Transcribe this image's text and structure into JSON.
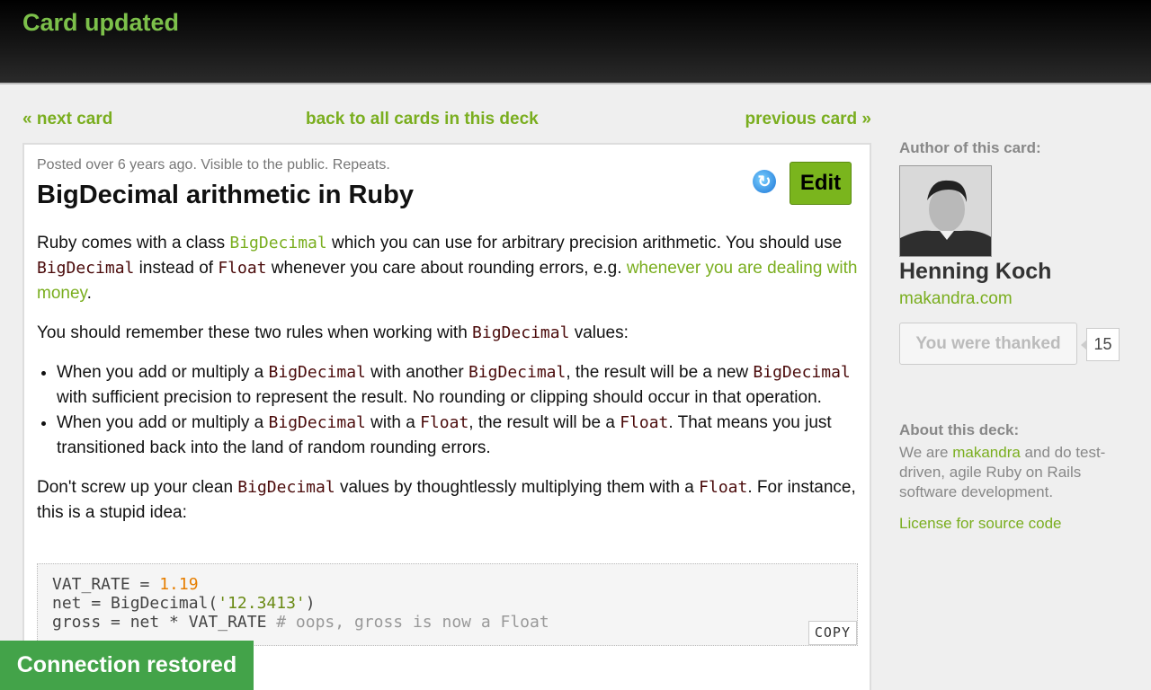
{
  "header": {
    "flash": "Card updated"
  },
  "nav": {
    "next": "« next card",
    "back": "back to all cards in this deck",
    "previous": "previous card »"
  },
  "card": {
    "meta": "Posted over 6 years ago. Visible to the public. Repeats.",
    "title": "BigDecimal arithmetic in Ruby",
    "edit_label": "Edit",
    "p1": {
      "t1": "Ruby comes with a class ",
      "c1": "BigDecimal",
      "t2": " which you can use for arbitrary precision arithmetic. You should use ",
      "c2": "BigDecimal",
      "t3": " instead of ",
      "c3": "Float",
      "t4": " whenever you care about rounding errors, e.g. ",
      "link": "whenever you are dealing with money",
      "t5": "."
    },
    "p2": {
      "t1": "You should remember these two rules when working with ",
      "c1": "BigDecimal",
      "t2": " values:"
    },
    "li1": {
      "t1": "When you add or multiply a ",
      "c1": "BigDecimal",
      "t2": " with another ",
      "c2": "BigDecimal",
      "t3": ", the result will be a new ",
      "c3": "BigDecimal",
      "t4": " with sufficient precision to represent the result. No rounding or clipping should occur in that operation."
    },
    "li2": {
      "t1": "When you add or multiply a ",
      "c1": "BigDecimal",
      "t2": " with a ",
      "c2": "Float",
      "t3": ", the result will be a ",
      "c3": "Float",
      "t4": ". That means you just transitioned back into the land of random rounding errors."
    },
    "p3": {
      "t1": "Don't screw up your clean ",
      "c1": "BigDecimal",
      "t2": " values by thoughtlessly multiplying them with a ",
      "c2": "Float",
      "t3": ". For instance, this is a stupid idea:"
    },
    "code": {
      "l1a": "VAT_RATE = ",
      "l1b": "1.19",
      "l2a": "net = BigDecimal(",
      "l2b": "'12.3413'",
      "l2c": ")",
      "l3a": "gross = net * VAT_RATE ",
      "l3b": "# oops, gross is now a Float",
      "copy": "COPY"
    }
  },
  "sidebar": {
    "author_heading": "Author of this card:",
    "author_name": "Henning Koch",
    "author_site": "makandra.com",
    "thank_label": "You were thanked",
    "thank_count": "15",
    "about_heading": "About this deck:",
    "about_t1": "We are ",
    "about_link": "makandra",
    "about_t2": " and do test-driven, agile Ruby on Rails software development.",
    "license": "License for source code"
  },
  "toast": "Connection restored",
  "colors": {
    "accent": "#7aae1f",
    "toast": "#43a349",
    "topbar": "#000000"
  }
}
